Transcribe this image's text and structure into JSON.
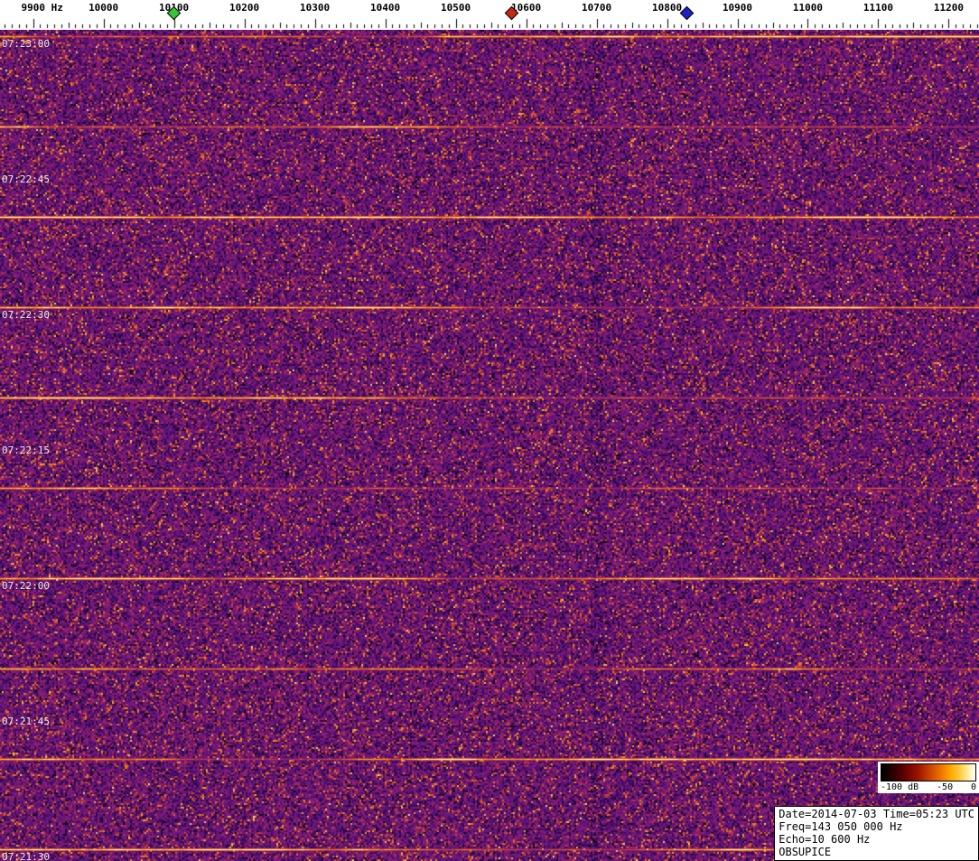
{
  "chart_data": {
    "type": "heatmap",
    "title": "radio meteor echo spectrogram",
    "x_axis": {
      "unit": "Hz",
      "freq_at_left_edge": 9853,
      "freq_at_right_edge": 11243,
      "major_tick_step_hz": 100,
      "minor_tick_step_hz": 10,
      "tick_values": [
        9900,
        10000,
        10100,
        10200,
        10300,
        10400,
        10500,
        10600,
        10700,
        10800,
        10900,
        11000,
        11100,
        11200
      ],
      "tick_labels": [
        "9900 Hz",
        "10000",
        "10100",
        "10200",
        "10300",
        "10400",
        "10500",
        "10600",
        "10700",
        "10800",
        "10900",
        "11000",
        "11100",
        "11200"
      ]
    },
    "y_axis": {
      "unit": "UTC time",
      "direction": "down = earlier",
      "seconds_per_label": 15,
      "time_labels": [
        "07:23:00",
        "07:22:45",
        "07:22:30",
        "07:22:15",
        "07:22:00",
        "07:21:45",
        "07:21:30"
      ]
    },
    "markers": [
      {
        "id": "green-marker",
        "freq_hz": 10100,
        "color": "#38c438"
      },
      {
        "id": "red-marker",
        "freq_hz": 10580,
        "color": "#c42814"
      },
      {
        "id": "blue-marker",
        "freq_hz": 10828,
        "color": "#2020c4"
      }
    ],
    "sweep_lines": {
      "interval_seconds": 10,
      "times": [
        "07:23:00",
        "07:22:50",
        "07:22:40",
        "07:22:30",
        "07:22:20",
        "07:22:10",
        "07:22:00",
        "07:21:50",
        "07:21:40",
        "07:21:30"
      ],
      "description": "bright horizontal echo lines every 10 s"
    },
    "colormap": "black-purple-orange-yellow-white",
    "value_range_db": [
      -100,
      0
    ]
  },
  "colorbar": {
    "labels": [
      "-100 dB",
      "-50",
      "0"
    ]
  },
  "info_box": {
    "line1": "Date=2014-07-03 Time=05:23 UTC",
    "line2": "Freq=143 050 000 Hz",
    "line3": "Echo=10 600 Hz",
    "line4": "OBSUPICE"
  }
}
